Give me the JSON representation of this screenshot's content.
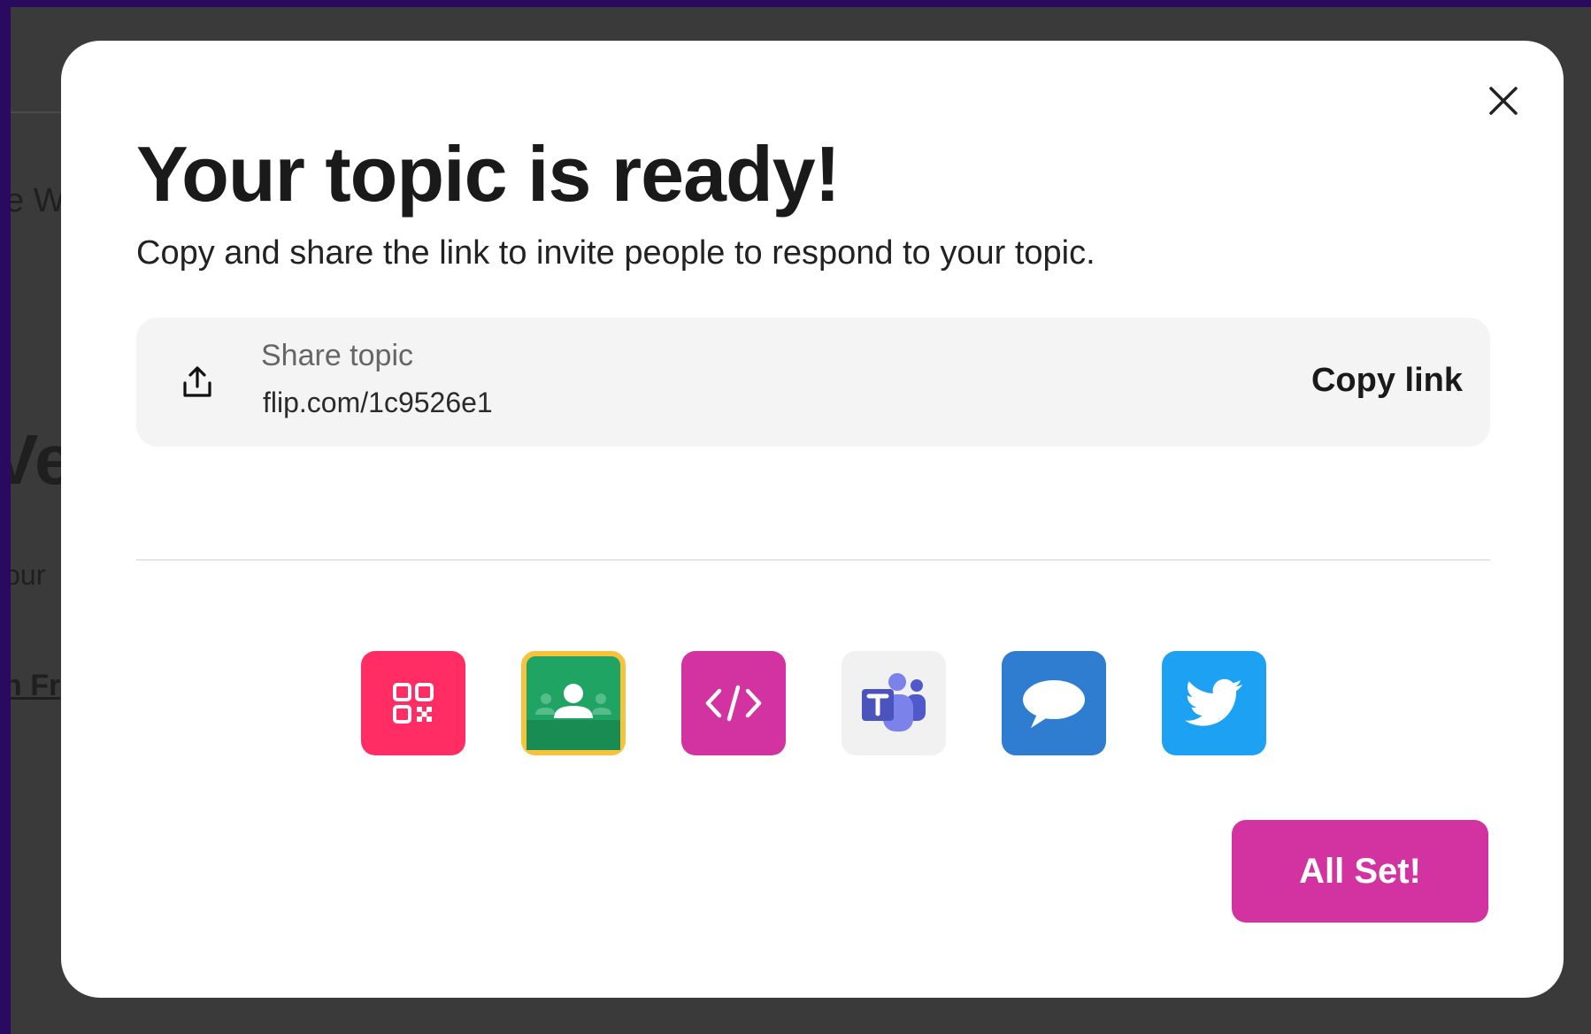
{
  "background": {
    "fragments": [
      "e W",
      "Ve",
      "jour",
      "n Fr"
    ]
  },
  "modal": {
    "close_glyph": "×",
    "title": "Your topic is ready!",
    "subtitle": "Copy and share the link to invite people to respond to your topic.",
    "share": {
      "label": "Share topic",
      "url": "flip.com/1c9526e1",
      "copy_label": "Copy link",
      "icon": "share-upload-icon"
    },
    "share_targets": [
      {
        "name": "qr-code",
        "icon": "qr-code-icon",
        "color": "#ff2d64"
      },
      {
        "name": "google-classroom",
        "icon": "google-classroom-icon",
        "color": "#1fa463"
      },
      {
        "name": "embed",
        "icon": "code-embed-icon",
        "color": "#d233a1"
      },
      {
        "name": "microsoft-teams",
        "icon": "microsoft-teams-icon",
        "color": "#5059c9"
      },
      {
        "name": "remind",
        "icon": "remind-chat-icon",
        "color": "#2f7dd1"
      },
      {
        "name": "twitter",
        "icon": "twitter-bird-icon",
        "color": "#1da1f2"
      }
    ],
    "done_label": "All Set!"
  },
  "colors": {
    "accent": "#d233a1",
    "page_border": "#2a0a5e",
    "overlay": "#3a3a3a"
  }
}
